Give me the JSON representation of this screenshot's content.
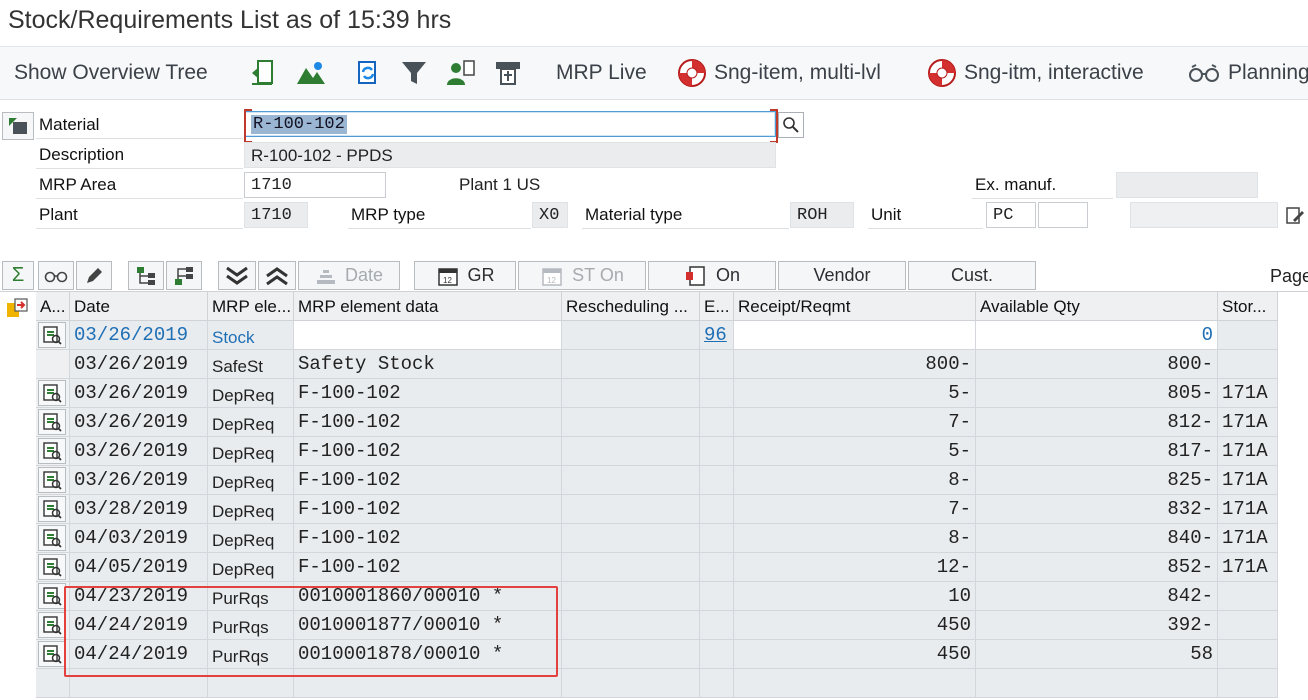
{
  "title": "Stock/Requirements List as of 15:39 hrs",
  "toolbar": {
    "show_overview_tree": "Show Overview Tree",
    "mrp_live": "MRP Live",
    "sng_item_multi": "Sng-item, multi-lvl",
    "sng_item_interactive": "Sng-itm, interactive",
    "planning": "Planning"
  },
  "form": {
    "material_label": "Material",
    "material_value": "R-100-102",
    "description_label": "Description",
    "description_value": "R-100-102 - PPDS",
    "mrp_area_label": "MRP Area",
    "mrp_area_value": "1710",
    "plant_text": "Plant 1 US",
    "ex_manuf_label": "Ex. manuf.",
    "plant_label": "Plant",
    "plant_value": "1710",
    "mrp_type_label": "MRP type",
    "mrp_type_value": "X0",
    "material_type_label": "Material type",
    "material_type_value": "ROH",
    "unit_label": "Unit",
    "unit_value": "PC"
  },
  "gridbar": {
    "sigma": "Σ",
    "date": "Date",
    "gr": "GR",
    "st_on": "ST On",
    "on": "On",
    "vendor": "Vendor",
    "cust": "Cust.",
    "page": "Page"
  },
  "columns": {
    "a": "A...",
    "date": "Date",
    "mrp_element": "MRP ele...",
    "mrp_element_data": "MRP element data",
    "rescheduling": "Rescheduling ...",
    "e": "E...",
    "receipt_reqmt": "Receipt/Reqmt",
    "available_qty": "Available Qty",
    "storage": "Stor..."
  },
  "rows": [
    {
      "date": "03/26/2019",
      "element": "Stock",
      "data": "",
      "e": "96",
      "receipt": "",
      "available": "0",
      "stor": "",
      "blue": true,
      "icon": true
    },
    {
      "date": "03/26/2019",
      "element": "SafeSt",
      "data": "Safety Stock",
      "e": "",
      "receipt": "800-",
      "available": "800-",
      "stor": "",
      "blue": false,
      "icon": false
    },
    {
      "date": "03/26/2019",
      "element": "DepReq",
      "data": "F-100-102",
      "e": "",
      "receipt": "5-",
      "available": "805-",
      "stor": "171A",
      "blue": false,
      "icon": true
    },
    {
      "date": "03/26/2019",
      "element": "DepReq",
      "data": "F-100-102",
      "e": "",
      "receipt": "7-",
      "available": "812-",
      "stor": "171A",
      "blue": false,
      "icon": true
    },
    {
      "date": "03/26/2019",
      "element": "DepReq",
      "data": "F-100-102",
      "e": "",
      "receipt": "5-",
      "available": "817-",
      "stor": "171A",
      "blue": false,
      "icon": true
    },
    {
      "date": "03/26/2019",
      "element": "DepReq",
      "data": "F-100-102",
      "e": "",
      "receipt": "8-",
      "available": "825-",
      "stor": "171A",
      "blue": false,
      "icon": true
    },
    {
      "date": "03/28/2019",
      "element": "DepReq",
      "data": "F-100-102",
      "e": "",
      "receipt": "7-",
      "available": "832-",
      "stor": "171A",
      "blue": false,
      "icon": true
    },
    {
      "date": "04/03/2019",
      "element": "DepReq",
      "data": "F-100-102",
      "e": "",
      "receipt": "8-",
      "available": "840-",
      "stor": "171A",
      "blue": false,
      "icon": true
    },
    {
      "date": "04/05/2019",
      "element": "DepReq",
      "data": "F-100-102",
      "e": "",
      "receipt": "12-",
      "available": "852-",
      "stor": "171A",
      "blue": false,
      "icon": true
    },
    {
      "date": "04/23/2019",
      "element": "PurRqs",
      "data": "0010001860/00010 *",
      "e": "",
      "receipt": "10",
      "available": "842-",
      "stor": "",
      "blue": false,
      "icon": true
    },
    {
      "date": "04/24/2019",
      "element": "PurRqs",
      "data": "0010001877/00010 *",
      "e": "",
      "receipt": "450",
      "available": "392-",
      "stor": "",
      "blue": false,
      "icon": true
    },
    {
      "date": "04/24/2019",
      "element": "PurRqs",
      "data": "0010001878/00010 *",
      "e": "",
      "receipt": "450",
      "available": "58",
      "stor": "",
      "blue": false,
      "icon": true
    }
  ]
}
